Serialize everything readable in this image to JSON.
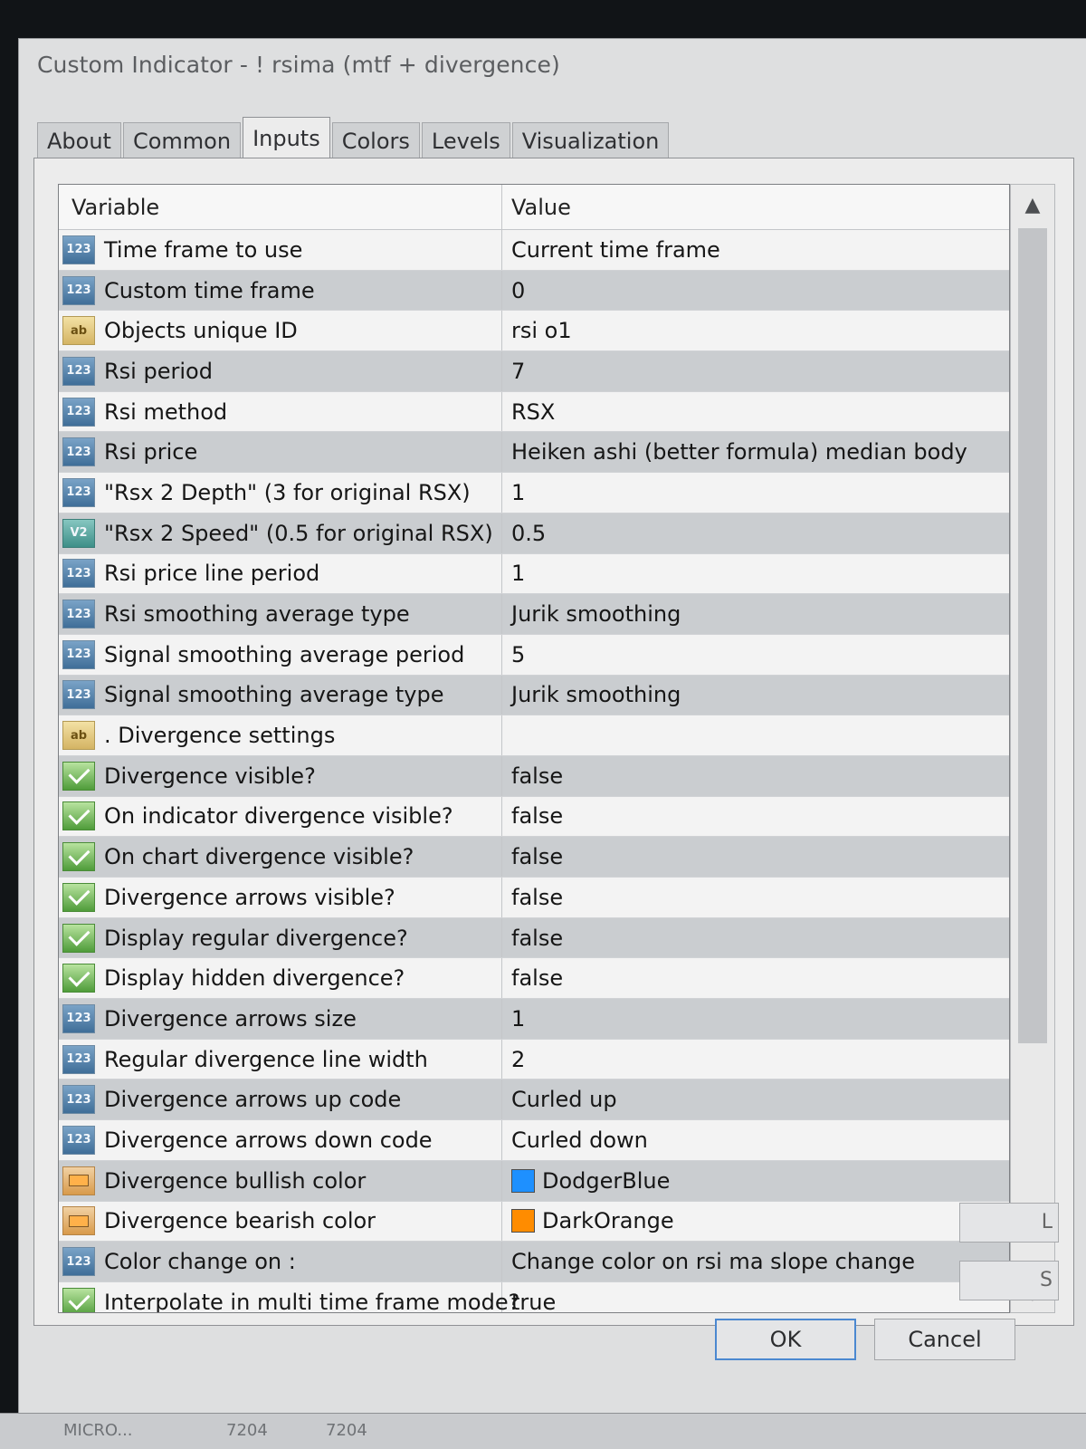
{
  "dialog": {
    "title": "Custom Indicator - ! rsima (mtf + divergence)",
    "tabs": [
      "About",
      "Common",
      "Inputs",
      "Colors",
      "Levels",
      "Visualization"
    ],
    "active_tab": "Inputs"
  },
  "table": {
    "headers": {
      "variable": "Variable",
      "value": "Value"
    },
    "rows": [
      {
        "icon": "int",
        "variable": "Time frame to use",
        "value": "Current time frame"
      },
      {
        "icon": "int",
        "variable": "Custom time frame",
        "value": "0"
      },
      {
        "icon": "string",
        "variable": "Objects unique ID",
        "value": "rsi o1"
      },
      {
        "icon": "int",
        "variable": "Rsi period",
        "value": "7"
      },
      {
        "icon": "int",
        "variable": "Rsi method",
        "value": "RSX"
      },
      {
        "icon": "int",
        "variable": "Rsi price",
        "value": "Heiken ashi (better formula) median body"
      },
      {
        "icon": "int",
        "variable": "\"Rsx 2 Depth\" (3 for original RSX)",
        "value": "1"
      },
      {
        "icon": "double",
        "variable": "\"Rsx 2 Speed\" (0.5 for original RSX)",
        "value": "0.5"
      },
      {
        "icon": "int",
        "variable": "Rsi price line period",
        "value": "1"
      },
      {
        "icon": "int",
        "variable": "Rsi smoothing average type",
        "value": "Jurik smoothing"
      },
      {
        "icon": "int",
        "variable": "Signal smoothing average period",
        "value": "5"
      },
      {
        "icon": "int",
        "variable": "Signal smoothing average type",
        "value": "Jurik smoothing"
      },
      {
        "icon": "string",
        "variable": ". Divergence settings",
        "value": ""
      },
      {
        "icon": "bool",
        "variable": "Divergence visible?",
        "value": "false"
      },
      {
        "icon": "bool",
        "variable": "On indicator divergence visible?",
        "value": "false"
      },
      {
        "icon": "bool",
        "variable": "On chart divergence visible?",
        "value": "false"
      },
      {
        "icon": "bool",
        "variable": "Divergence arrows visible?",
        "value": "false"
      },
      {
        "icon": "bool",
        "variable": "Display regular divergence?",
        "value": "false"
      },
      {
        "icon": "bool",
        "variable": "Display hidden divergence?",
        "value": "false"
      },
      {
        "icon": "int",
        "variable": "Divergence arrows size",
        "value": "1"
      },
      {
        "icon": "int",
        "variable": "Regular divergence line width",
        "value": "2"
      },
      {
        "icon": "int",
        "variable": "Divergence arrows up code",
        "value": "Curled up"
      },
      {
        "icon": "int",
        "variable": "Divergence arrows down code",
        "value": "Curled down"
      },
      {
        "icon": "color",
        "variable": "Divergence bullish color",
        "value": "DodgerBlue",
        "swatch": "#1e90ff"
      },
      {
        "icon": "color",
        "variable": "Divergence bearish color",
        "value": "DarkOrange",
        "swatch": "#ff8c00"
      },
      {
        "icon": "int",
        "variable": "Color change on :",
        "value": "Change color on rsi ma slope change"
      },
      {
        "icon": "bool",
        "variable": "Interpolate in multi time frame mode?",
        "value": "true"
      }
    ]
  },
  "icons": {
    "int": "123",
    "string": "ab",
    "double": "V2"
  },
  "buttons": {
    "ok": "OK",
    "cancel": "Cancel"
  },
  "side_buttons": [
    "L",
    "S"
  ],
  "taskbar": {
    "left": "MICRO...",
    "mid1": "7204",
    "mid2": "7204"
  }
}
